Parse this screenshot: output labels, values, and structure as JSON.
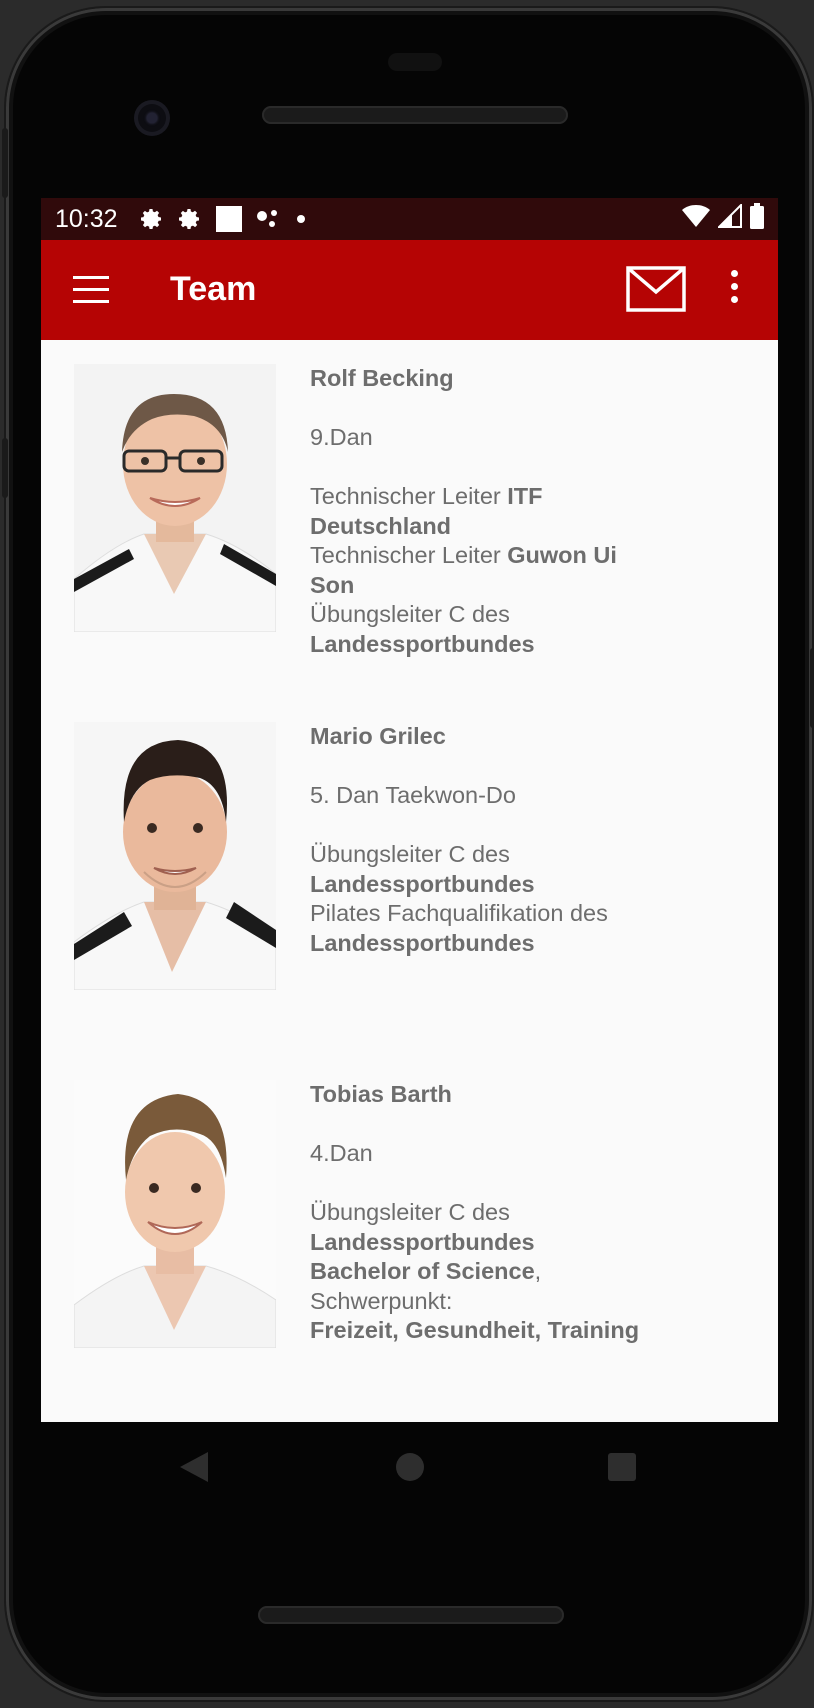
{
  "status_bar": {
    "time": "10:32",
    "icons": [
      "gear-icon",
      "gear-icon",
      "square-notification-icon",
      "dots-icon",
      "dot-icon"
    ],
    "right_icons": [
      "wifi-icon",
      "signal-icon",
      "battery-icon"
    ]
  },
  "app_bar": {
    "title": "Team",
    "menu_icon": "hamburger-menu-icon",
    "mail_icon": "mail-icon",
    "more_icon": "more-vert-icon",
    "color": "#b50404"
  },
  "members": [
    {
      "name": "Rolf Becking",
      "rank": "9.Dan",
      "details": [
        {
          "normal": "Technischer Leiter ",
          "bold": "ITF Deutschland"
        },
        {
          "normal": "Technischer Leiter ",
          "bold": "Guwon Ui Son"
        },
        {
          "normal": "Übungsleiter C des ",
          "bold": "Landessportbundes"
        }
      ]
    },
    {
      "name": "Mario Grilec",
      "rank": "5. Dan Taekwon-Do",
      "details": [
        {
          "normal": "Übungsleiter C des ",
          "bold": "Landessportbundes"
        },
        {
          "normal": "Pilates Fachqualifikation des ",
          "bold": "Landessportbundes"
        }
      ]
    },
    {
      "name": "Tobias Barth",
      "rank": "4.Dan",
      "details": [
        {
          "normal": "Übungsleiter C des ",
          "bold": "Landessportbundes"
        },
        {
          "normal": "",
          "bold": "Bachelor of Science",
          "suffix": ","
        },
        {
          "normal": "Schwerpunkt:",
          "bold": ""
        },
        {
          "normal": "",
          "bold": "Freizeit, Gesundheit, Training"
        }
      ]
    }
  ],
  "nav_bar": {
    "back_icon": "back-triangle-icon",
    "home_icon": "home-circle-icon",
    "recent_icon": "recents-square-icon"
  }
}
